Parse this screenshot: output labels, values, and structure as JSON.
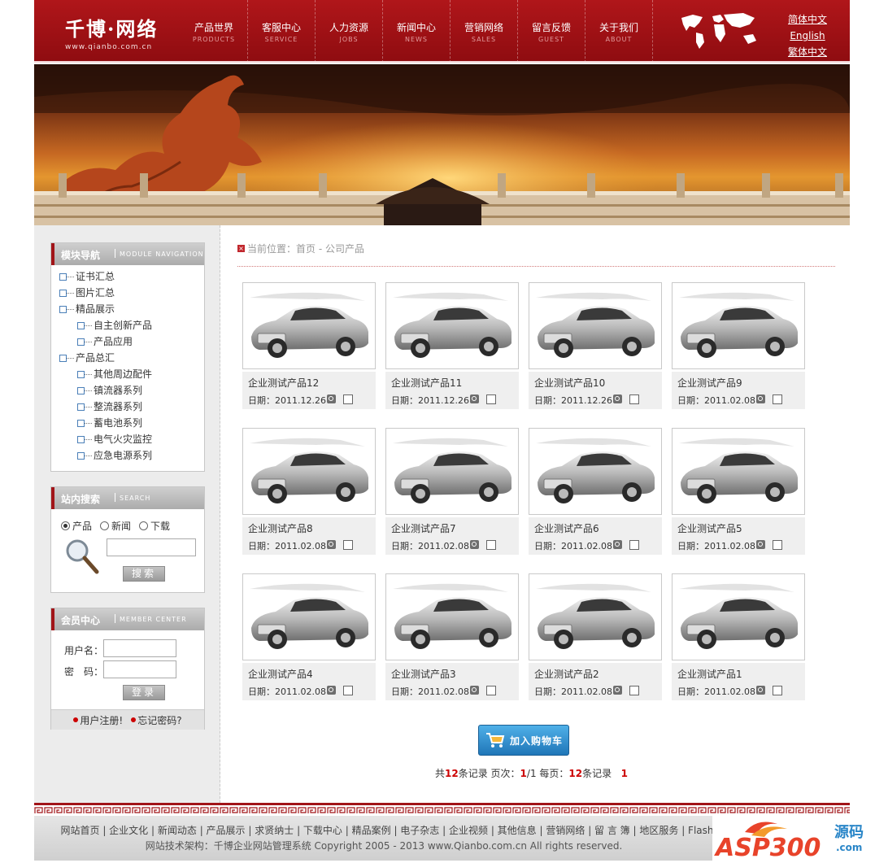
{
  "header": {
    "logo_title": "千博·网络",
    "logo_url": "www.qianbo.com.cn",
    "nav": [
      {
        "cn": "产品世界",
        "en": "PRODUCTS"
      },
      {
        "cn": "客服中心",
        "en": "SERVICE"
      },
      {
        "cn": "人力资源",
        "en": "JOBS"
      },
      {
        "cn": "新闻中心",
        "en": "NEWS"
      },
      {
        "cn": "营销网络",
        "en": "SALES"
      },
      {
        "cn": "留言反馈",
        "en": "GUEST"
      },
      {
        "cn": "关于我们",
        "en": "ABOUT"
      }
    ],
    "languages": [
      "简体中文",
      "English",
      "繁体中文"
    ]
  },
  "sidebar": {
    "module_nav": {
      "title": "模块导航",
      "subtitle": "MODULE NAVIGATION",
      "items": [
        {
          "label": "证书汇总",
          "child": false
        },
        {
          "label": "图片汇总",
          "child": false
        },
        {
          "label": "精品展示",
          "child": false
        },
        {
          "label": "自主创新产品",
          "child": true
        },
        {
          "label": "产品应用",
          "child": true
        },
        {
          "label": "产品总汇",
          "child": false
        },
        {
          "label": "其他周边配件",
          "child": true
        },
        {
          "label": "镇流器系列",
          "child": true
        },
        {
          "label": "整流器系列",
          "child": true
        },
        {
          "label": "蓄电池系列",
          "child": true
        },
        {
          "label": "电气火灾监控",
          "child": true
        },
        {
          "label": "应急电源系列",
          "child": true
        }
      ]
    },
    "search": {
      "title": "站内搜索",
      "subtitle": "SEARCH",
      "options": [
        "产品",
        "新闻",
        "下载"
      ],
      "selected": "产品",
      "button": "搜索"
    },
    "member": {
      "title": "会员中心",
      "subtitle": "MEMBER CENTER",
      "username_label": "用户名：",
      "password_label": "密　码：",
      "login_button": "登录",
      "register_link": "用户注册!",
      "forgot_link": "忘记密码?"
    }
  },
  "main": {
    "breadcrumb": "当前位置：首页 - 公司产品",
    "products": [
      {
        "name": "企业测试产品12",
        "date": "日期：2011.12.26"
      },
      {
        "name": "企业测试产品11",
        "date": "日期：2011.12.26"
      },
      {
        "name": "企业测试产品10",
        "date": "日期：2011.12.26"
      },
      {
        "name": "企业测试产品9",
        "date": "日期：2011.02.08"
      },
      {
        "name": "企业测试产品8",
        "date": "日期：2011.02.08"
      },
      {
        "name": "企业测试产品7",
        "date": "日期：2011.02.08"
      },
      {
        "name": "企业测试产品6",
        "date": "日期：2011.02.08"
      },
      {
        "name": "企业测试产品5",
        "date": "日期：2011.02.08"
      },
      {
        "name": "企业测试产品4",
        "date": "日期：2011.02.08"
      },
      {
        "name": "企业测试产品3",
        "date": "日期：2011.02.08"
      },
      {
        "name": "企业测试产品2",
        "date": "日期：2011.02.08"
      },
      {
        "name": "企业测试产品1",
        "date": "日期：2011.02.08"
      }
    ],
    "cart_button": "加入购物车",
    "pager": {
      "prefix": "共",
      "total": "12",
      "records": "条记录 页次：",
      "page": "1",
      "pages": "/1 每页：",
      "per_page": "12",
      "per_suffix": "条记录",
      "link": "1"
    }
  },
  "footer": {
    "links": [
      "网站首页",
      "企业文化",
      "新闻动态",
      "产品展示",
      "求贤纳士",
      "下载中心",
      "精品案例",
      "电子杂志",
      "企业视频",
      "其他信息",
      "营销网络",
      "留 言 簿",
      "地区服务",
      "Flash版"
    ],
    "copyright": "网站技术架构：千博企业网站管理系统  Copyright 2005 - 2013 www.Qianbo.com.cn All rights reserved."
  },
  "watermark": {
    "brand": "ASP300",
    "suffix": "源码",
    "tld": ".com"
  },
  "colors": {
    "brand_red": "#a11418",
    "accent_blue": "#2a86c8"
  }
}
